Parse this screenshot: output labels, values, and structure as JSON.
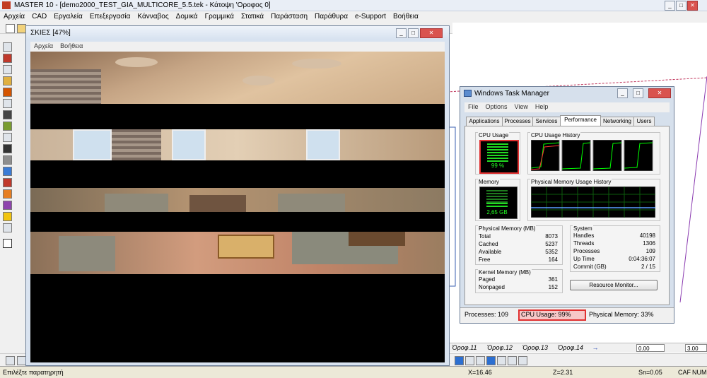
{
  "main": {
    "title": "MASTER 10 - [demo2000_TEST_GIA_MULTICORE_5.5.tek - Κάτοψη 'Οροφος 0]",
    "menu": [
      "Αρχεία",
      "CAD",
      "Εργαλεία",
      "Επεξεργασία",
      "Κάνναβος",
      "Δομικά",
      "Γραμμικά",
      "Στατικά",
      "Παράσταση",
      "Παράθυρα",
      "e-Support",
      "Βοήθεια"
    ],
    "floor_tabs": [
      "Όροφ.11",
      "Όροφ.12",
      "Όροφ.13",
      "Όροφ.14"
    ],
    "field1": "0.00",
    "field2": "3.00",
    "status": {
      "message": "Επιλέξτε παρατηρητή",
      "x": "X=16.46",
      "z": "Z=2.31",
      "sn": "Sn=0.05",
      "caf": "CAF",
      "num": "NUM"
    }
  },
  "render": {
    "title": "ΣΚΙΕΣ [47%]",
    "menu": [
      "Αρχεία",
      "Βοήθεια"
    ],
    "progress": 0.47
  },
  "taskmgr": {
    "title": "Windows Task Manager",
    "menu": [
      "File",
      "Options",
      "View",
      "Help"
    ],
    "tabs": [
      "Applications",
      "Processes",
      "Services",
      "Performance",
      "Networking",
      "Users"
    ],
    "active_tab": "Performance",
    "cpu_usage_label": "CPU Usage",
    "cpu_usage_value": "99 %",
    "cpu_history_label": "CPU Usage History",
    "memory_label": "Memory",
    "memory_value": "2,65 GB",
    "mem_history_label": "Physical Memory Usage History",
    "physical_memory": {
      "label": "Physical Memory (MB)",
      "rows": [
        [
          "Total",
          "8073"
        ],
        [
          "Cached",
          "5237"
        ],
        [
          "Available",
          "5352"
        ],
        [
          "Free",
          "164"
        ]
      ]
    },
    "kernel_memory": {
      "label": "Kernel Memory (MB)",
      "rows": [
        [
          "Paged",
          "361"
        ],
        [
          "Nonpaged",
          "152"
        ]
      ]
    },
    "system": {
      "label": "System",
      "rows": [
        [
          "Handles",
          "40198"
        ],
        [
          "Threads",
          "1306"
        ],
        [
          "Processes",
          "109"
        ],
        [
          "Up Time",
          "0:04:36:07"
        ],
        [
          "Commit (GB)",
          "2 / 15"
        ]
      ]
    },
    "resource_monitor_button": "Resource Monitor...",
    "status": {
      "processes": "Processes: 109",
      "cpu": "CPU Usage: 99%",
      "memory": "Physical Memory: 33%"
    },
    "colors": {
      "graph": "#00ff00",
      "highlight": "#e03030"
    }
  }
}
